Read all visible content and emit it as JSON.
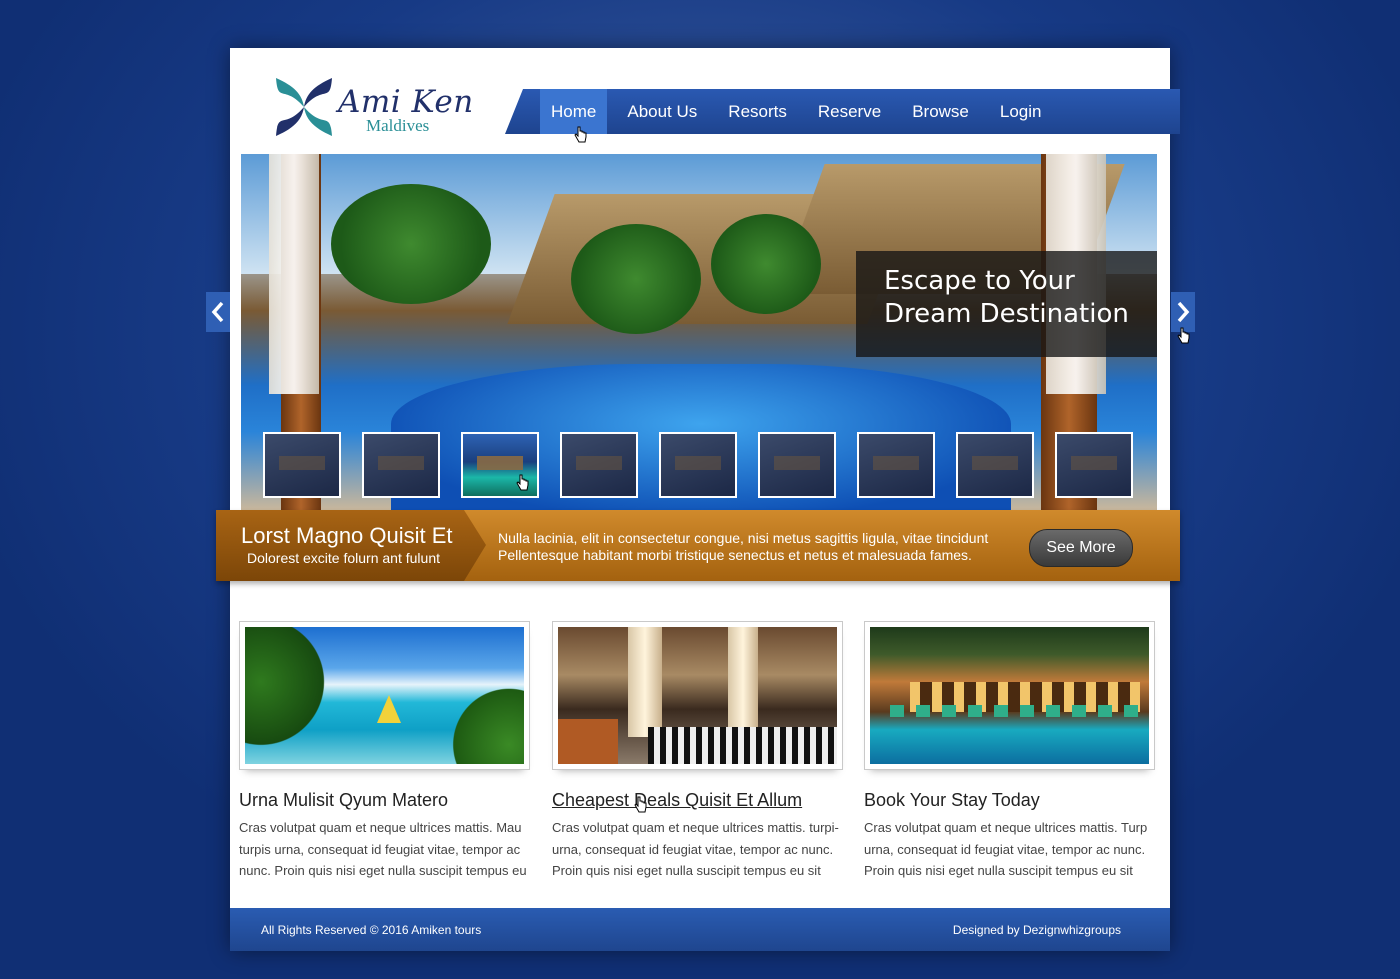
{
  "brand": {
    "name": "Ami Ken",
    "tagline": "Maldives"
  },
  "nav": {
    "items": [
      {
        "label": "Home",
        "active": true
      },
      {
        "label": "About Us",
        "active": false
      },
      {
        "label": "Resorts",
        "active": false
      },
      {
        "label": "Reserve",
        "active": false
      },
      {
        "label": "Browse",
        "active": false
      },
      {
        "label": "Login",
        "active": false
      }
    ]
  },
  "hero": {
    "caption": "Escape to Your Dream Destination",
    "thumbnail_count": 9,
    "active_thumbnail": 3,
    "prev_icon": "chevron-left-icon",
    "next_icon": "chevron-right-icon"
  },
  "band": {
    "title": "Lorst Magno Quisit Et",
    "subtitle": "Dolorest excite folurn ant fulunt",
    "text_line1": "Nulla lacinia, elit in consectetur congue, nisi metus sagittis ligula, vitae tincidunt",
    "text_line2": "Pellentesque habitant morbi tristique senectus et netus et malesuada fames.",
    "button": "See More"
  },
  "cards": [
    {
      "title": "Urna Mulisit Qyum Matero",
      "body": "Cras volutpat quam et neque ultrices mattis. Mau turpis urna, consequat id feugiat vitae, tempor ac nunc. Proin quis nisi eget nulla suscipit tempus eu"
    },
    {
      "title": "Cheapest Deals Quisit Et Allum",
      "body": "Cras volutpat quam et neque ultrices mattis. turpi- urna, consequat id feugiat vitae, tempor ac nunc. Proin quis nisi eget nulla suscipit tempus eu sit"
    },
    {
      "title": "Book Your Stay Today",
      "body": "Cras volutpat quam et neque ultrices mattis. Turp urna, consequat id feugiat vitae, tempor ac nunc. Proin quis nisi eget nulla suscipit tempus eu sit"
    }
  ],
  "footer": {
    "left": "All Rights Reserved © 2016  Amiken tours",
    "right": "Designed by Dezignwhizgroups"
  },
  "colors": {
    "nav_blue": "#2a59b2",
    "band_orange": "#c07a22",
    "footer_blue": "#2a5cb2",
    "background": "#173a85"
  }
}
